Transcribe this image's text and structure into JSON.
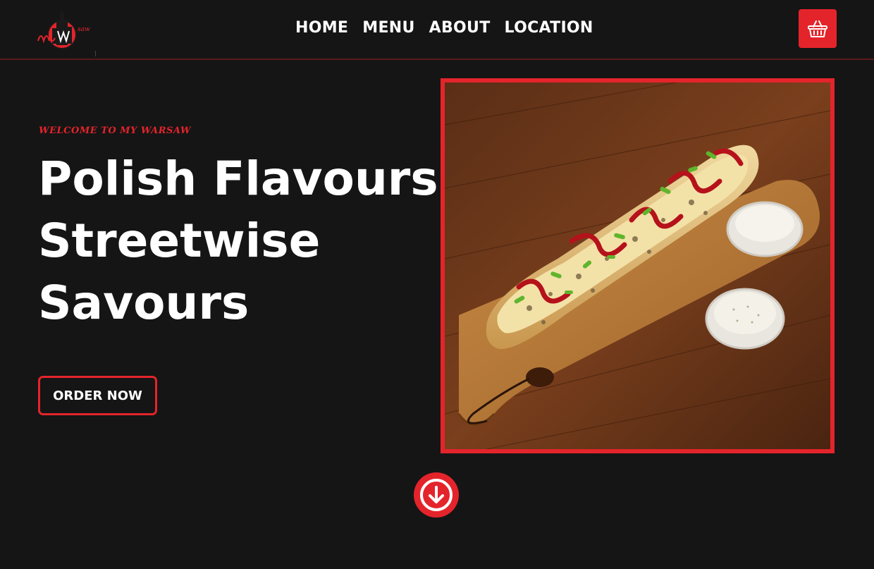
{
  "header": {
    "logo_text": "My Warsaw",
    "nav": [
      {
        "label": "HOME"
      },
      {
        "label": "MENU"
      },
      {
        "label": "ABOUT"
      },
      {
        "label": "LOCATION"
      }
    ],
    "cart_icon": "basket-icon"
  },
  "hero": {
    "eyebrow": "WELCOME TO MY WARSAW",
    "headline_lines": [
      "Polish Flavours",
      "Streetwise",
      "Savours"
    ],
    "cta_label": "ORDER NOW",
    "image_description": "zapiekanka-on-wooden-board",
    "scroll_icon": "arrow-down-circle-icon"
  },
  "colors": {
    "background": "#151515",
    "accent": "#e4242b",
    "text": "#ffffff"
  }
}
